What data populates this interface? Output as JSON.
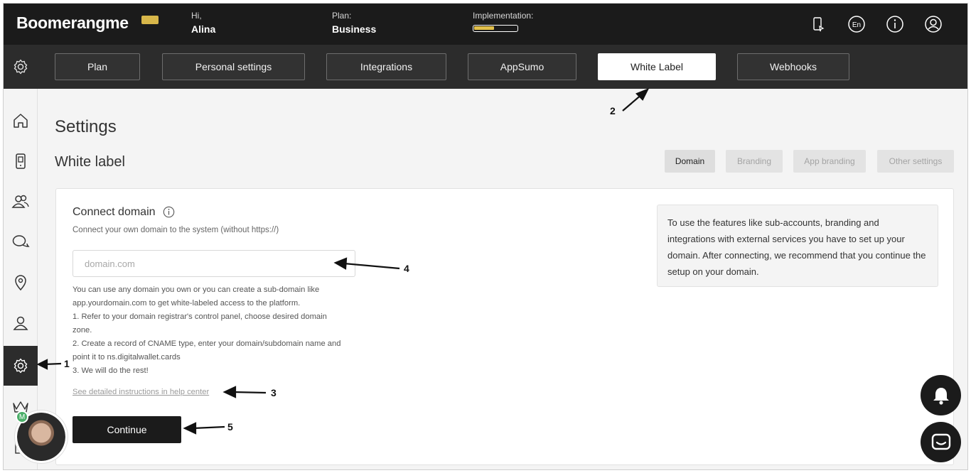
{
  "header": {
    "logo": "Boomerangme",
    "greeting_label": "Hi,",
    "user_name": "Alina",
    "plan_label": "Plan:",
    "plan_value": "Business",
    "implementation_label": "Implementation:",
    "implementation_progress": 0.45,
    "icons": [
      "phone-icon",
      "language-icon",
      "info-icon",
      "user-icon"
    ],
    "language": "En"
  },
  "settings_nav": {
    "items": [
      {
        "label": "Plan",
        "active": false
      },
      {
        "label": "Personal settings",
        "active": false
      },
      {
        "label": "Integrations",
        "active": false
      },
      {
        "label": "AppSumo",
        "active": false
      },
      {
        "label": "White Label",
        "active": true
      },
      {
        "label": "Webhooks",
        "active": false
      }
    ]
  },
  "sidebar": {
    "items": [
      "home-icon",
      "device-icon",
      "customers-icon",
      "chat-icon",
      "location-icon",
      "user-icon",
      "gear-icon",
      "crown-icon",
      "building-icon"
    ],
    "active": "gear-icon"
  },
  "main": {
    "page_title": "Settings",
    "section_title": "White label",
    "subtabs": [
      {
        "label": "Domain",
        "active": true
      },
      {
        "label": "Branding",
        "active": false
      },
      {
        "label": "App branding",
        "active": false
      },
      {
        "label": "Other settings",
        "active": false
      }
    ],
    "card": {
      "title": "Connect domain",
      "subtitle": "Connect your own domain to the system (without https://)",
      "input_placeholder": "domain.com",
      "input_value": "",
      "help_lines": [
        "You can use any domain you own or you can create a sub-domain like",
        "app.yourdomain.com to get white-labeled access to the platform.",
        "1. Refer to your domain registrar's control panel, choose desired domain",
        "zone.",
        "2. Create a record of CNAME type, enter your domain/subdomain name and",
        "point it to ns.digitalwallet.cards",
        "3. We will do the rest!"
      ],
      "help_link": "See detailed instructions in help center",
      "continue_label": "Continue",
      "notice": "To use the features like sub-accounts, branding and integrations with external services you have to set up your domain. After connecting, we recommend that you continue the setup on your domain."
    }
  },
  "annotations": [
    "1",
    "2",
    "3",
    "4",
    "5"
  ],
  "avatar_badge": "M",
  "colors": {
    "dark": "#1b1b1b",
    "nav_bg": "#2c2c2c",
    "accent_gold": "#e2c04a",
    "page_bg": "#f4f4f4"
  }
}
